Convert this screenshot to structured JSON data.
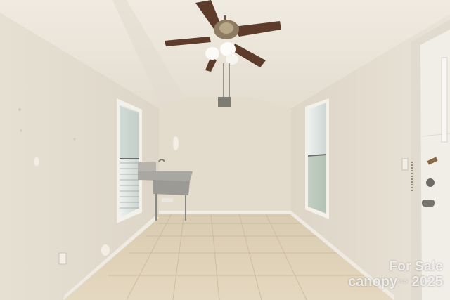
{
  "scene": {
    "description_items": [
      "ceiling-fan",
      "utility-sink",
      "left-window",
      "right-window",
      "exterior-door",
      "tile-floor"
    ]
  },
  "watermark": {
    "line1": "For Sale",
    "brand": "canopy",
    "brand_suffix": "MLS",
    "year": "2025"
  },
  "colors": {
    "wall_left": "#e7e1d4",
    "wall_back": "#e4ddcf",
    "wall_right": "#e9e3d7",
    "ceiling": "#ece6da",
    "floor": "#ddcdb1",
    "door": "#f1eee8"
  }
}
